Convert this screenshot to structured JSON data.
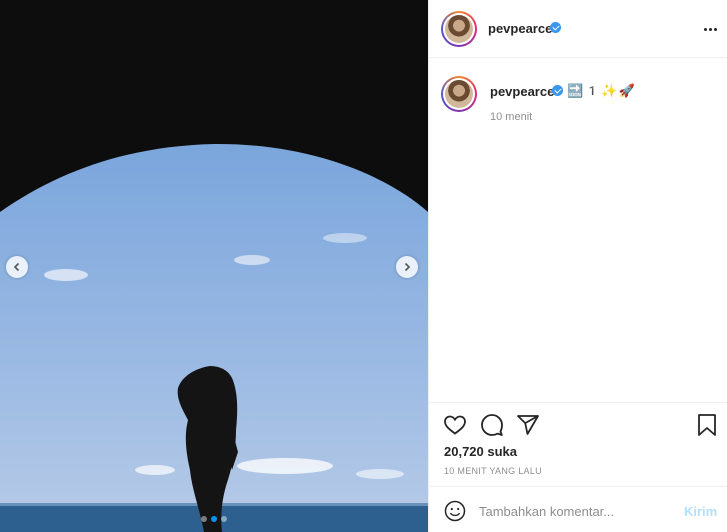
{
  "post": {
    "username": "pevpearce",
    "verified": true,
    "caption_emoji": "🔜1️✨🚀",
    "time_ago": "10 menit",
    "likes": "20,720 suka",
    "posted_label": "10 MENIT YANG LALU"
  },
  "media": {
    "slides": 3,
    "active_slide": 2
  },
  "comment": {
    "placeholder": "Tambahkan komentar...",
    "post_label": "Kirim"
  },
  "icons": {
    "more": "more-icon",
    "like": "heart-icon",
    "comment": "comment-icon",
    "share": "paper-plane-icon",
    "save": "bookmark-icon",
    "emoji": "smiley-icon",
    "prev": "chevron-left-icon",
    "next": "chevron-right-icon"
  },
  "colors": {
    "verified": "#3897f0",
    "active_dot": "#0095f6",
    "post_disabled": "#b2dffc",
    "muted_text": "#8e8e8e"
  }
}
